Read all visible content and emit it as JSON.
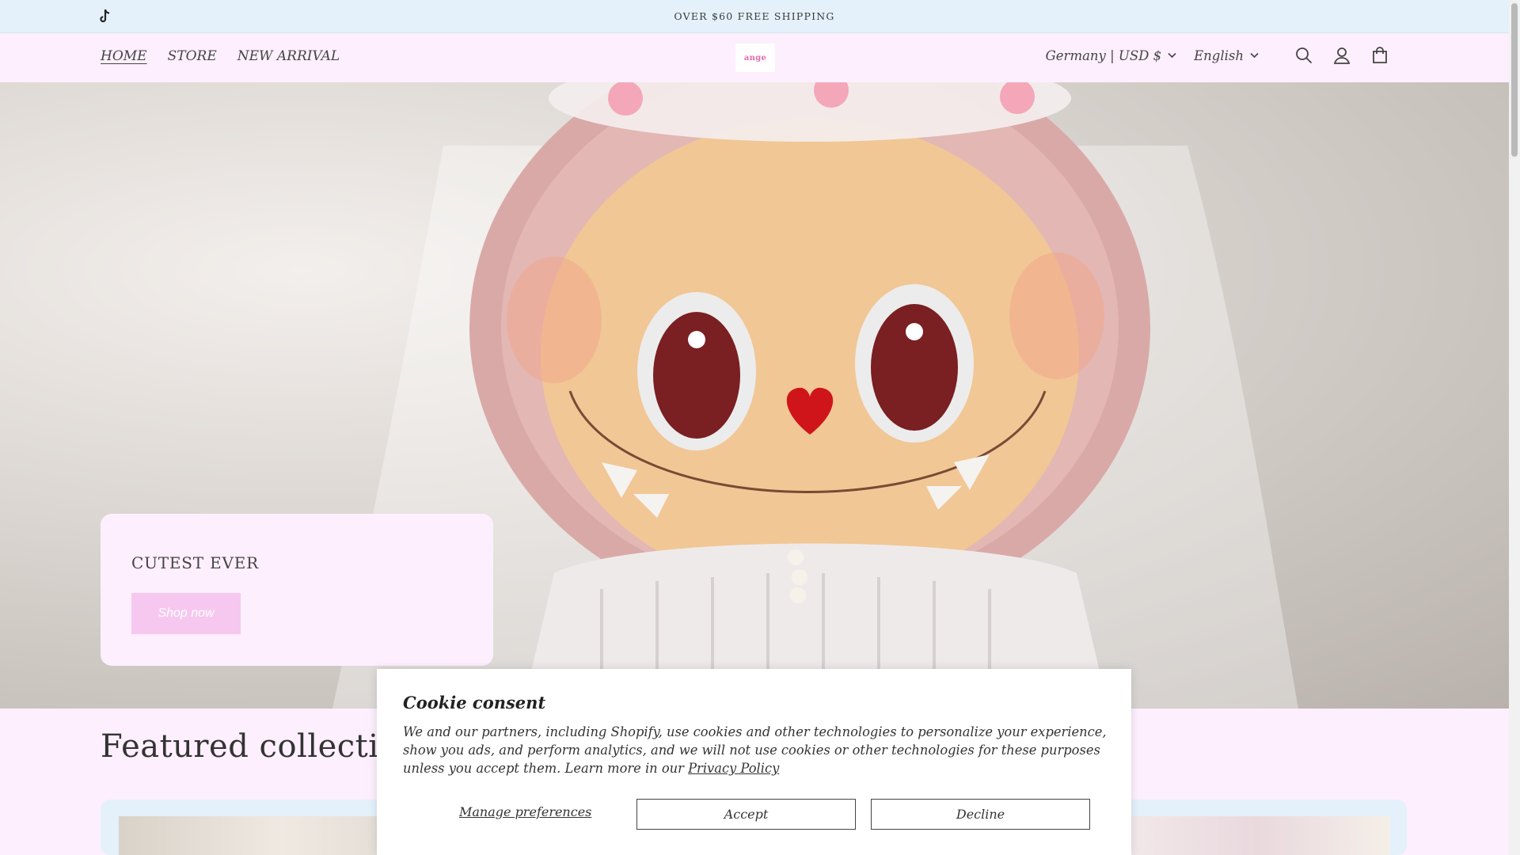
{
  "announcement": {
    "text": "OVER $60 FREE SHIPPING"
  },
  "header": {
    "nav": [
      {
        "label": "HOME",
        "active": true
      },
      {
        "label": "STORE",
        "active": false
      },
      {
        "label": "NEW ARRIVAL",
        "active": false
      }
    ],
    "logo_text": "ange",
    "country_selector": "Germany | USD $",
    "language_selector": "English",
    "icons": [
      "search-icon",
      "account-icon",
      "cart-icon",
      "tiktok-icon"
    ]
  },
  "hero": {
    "title": "CUTEST EVER",
    "button_label": "Shop now"
  },
  "featured": {
    "title": "Featured collection"
  },
  "cookie": {
    "title": "Cookie consent",
    "text": "We and our partners, including Shopify, use cookies and other technologies to personalize your experience, show you ads, and perform analytics, and we will not use cookies or other technologies for these purposes unless you accept them. Learn more in our ",
    "link": "Privacy Policy",
    "manage_label": "Manage preferences",
    "accept_label": "Accept",
    "decline_label": "Decline"
  },
  "colors": {
    "announcement_bg": "#e4f1fb",
    "page_bg": "#fdeffd",
    "button_pink": "#f6c8f0"
  }
}
